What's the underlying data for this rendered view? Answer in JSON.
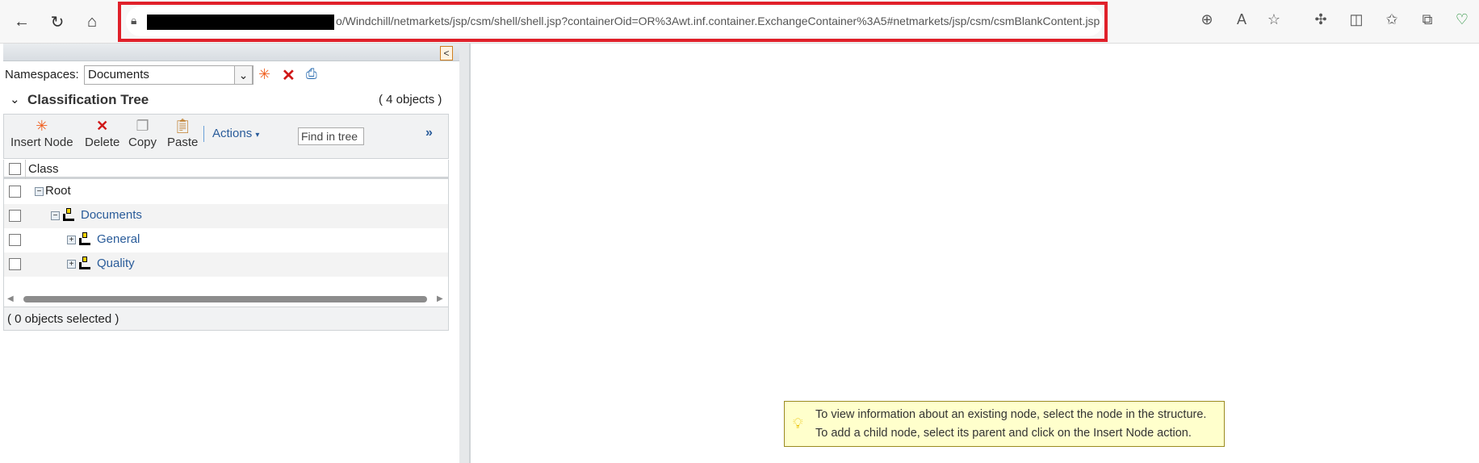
{
  "browser": {
    "url_visible": "o/Windchill/netmarkets/jsp/csm/shell/shell.jsp?containerOid=OR%3Awt.inf.container.ExchangeContainer%3A5#netmarkets/jsp/csm/csmBlankContent.jsp",
    "icons": [
      "back-icon",
      "refresh-icon",
      "home-icon",
      "lock-icon",
      "zoom-icon",
      "read-aloud-icon",
      "favorite-star-icon",
      "extensions-icon",
      "split-screen-icon",
      "favorites-icon",
      "collections-icon",
      "browser-essentials-icon"
    ]
  },
  "namespaces": {
    "label": "Namespaces:",
    "selected": "Documents"
  },
  "tree": {
    "title": "Classification Tree",
    "count": "( 4 objects )",
    "toolbar": {
      "insert": "Insert Node",
      "delete": "Delete",
      "copy": "Copy",
      "paste": "Paste",
      "actions": "Actions",
      "find_placeholder": "Find in tree",
      "more": "»"
    },
    "column": "Class",
    "rows": [
      {
        "label": "Root"
      },
      {
        "label": "Documents"
      },
      {
        "label": "General"
      },
      {
        "label": "Quality"
      }
    ],
    "status": "( 0 objects selected )"
  },
  "tip": {
    "line1": "To view information about an existing node, select the node in the structure.",
    "line2": "To add a child node, select its parent and click on the Insert Node action."
  },
  "colors": {
    "highlight": "#e0202a",
    "link": "#2a5c9a",
    "tip_bg": "#ffffcc"
  }
}
